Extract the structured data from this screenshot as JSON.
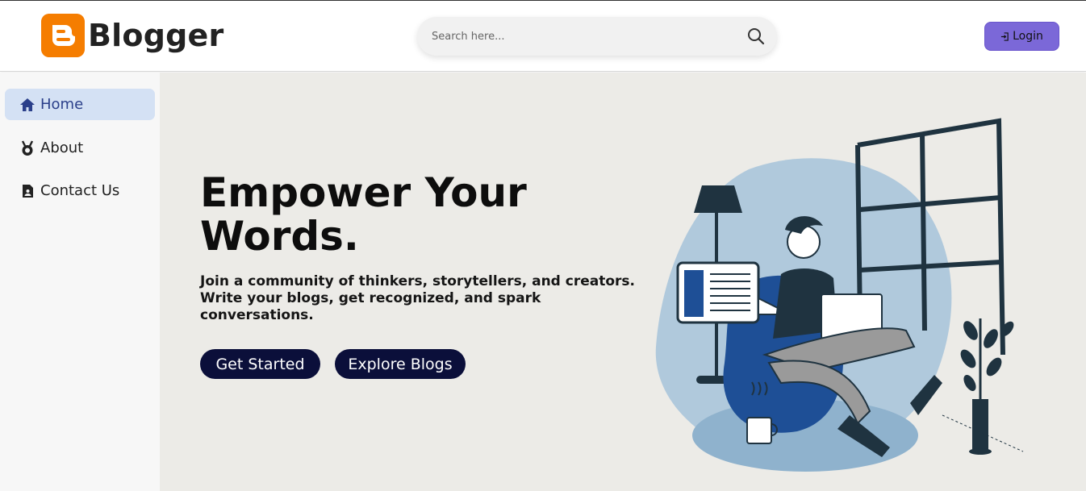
{
  "header": {
    "brand": "Blogger",
    "logo_icon": "blogger-logo-icon",
    "search": {
      "placeholder": "Search here...",
      "icon": "search-icon"
    },
    "login": {
      "label": "Login",
      "icon": "login-icon"
    }
  },
  "sidebar": {
    "items": [
      {
        "label": "Home",
        "icon": "home-icon",
        "active": true
      },
      {
        "label": "About",
        "icon": "medal-icon",
        "active": false
      },
      {
        "label": "Contact Us",
        "icon": "contact-card-icon",
        "active": false
      }
    ]
  },
  "hero": {
    "title": "Empower Your Words.",
    "subtitle": "Join a community of thinkers, storytellers, and creators. Write your blogs, get recognized, and spark conversations.",
    "buttons": {
      "get_started": "Get Started",
      "explore": "Explore Blogs"
    },
    "illustration": "man-with-laptop-illustration"
  },
  "colors": {
    "brand_orange": "#f57d00",
    "accent_purple": "#7b68d8",
    "active_nav_bg": "#d4e1f4",
    "button_navy": "#0b0f3a",
    "hero_bg": "#ecebe7"
  }
}
